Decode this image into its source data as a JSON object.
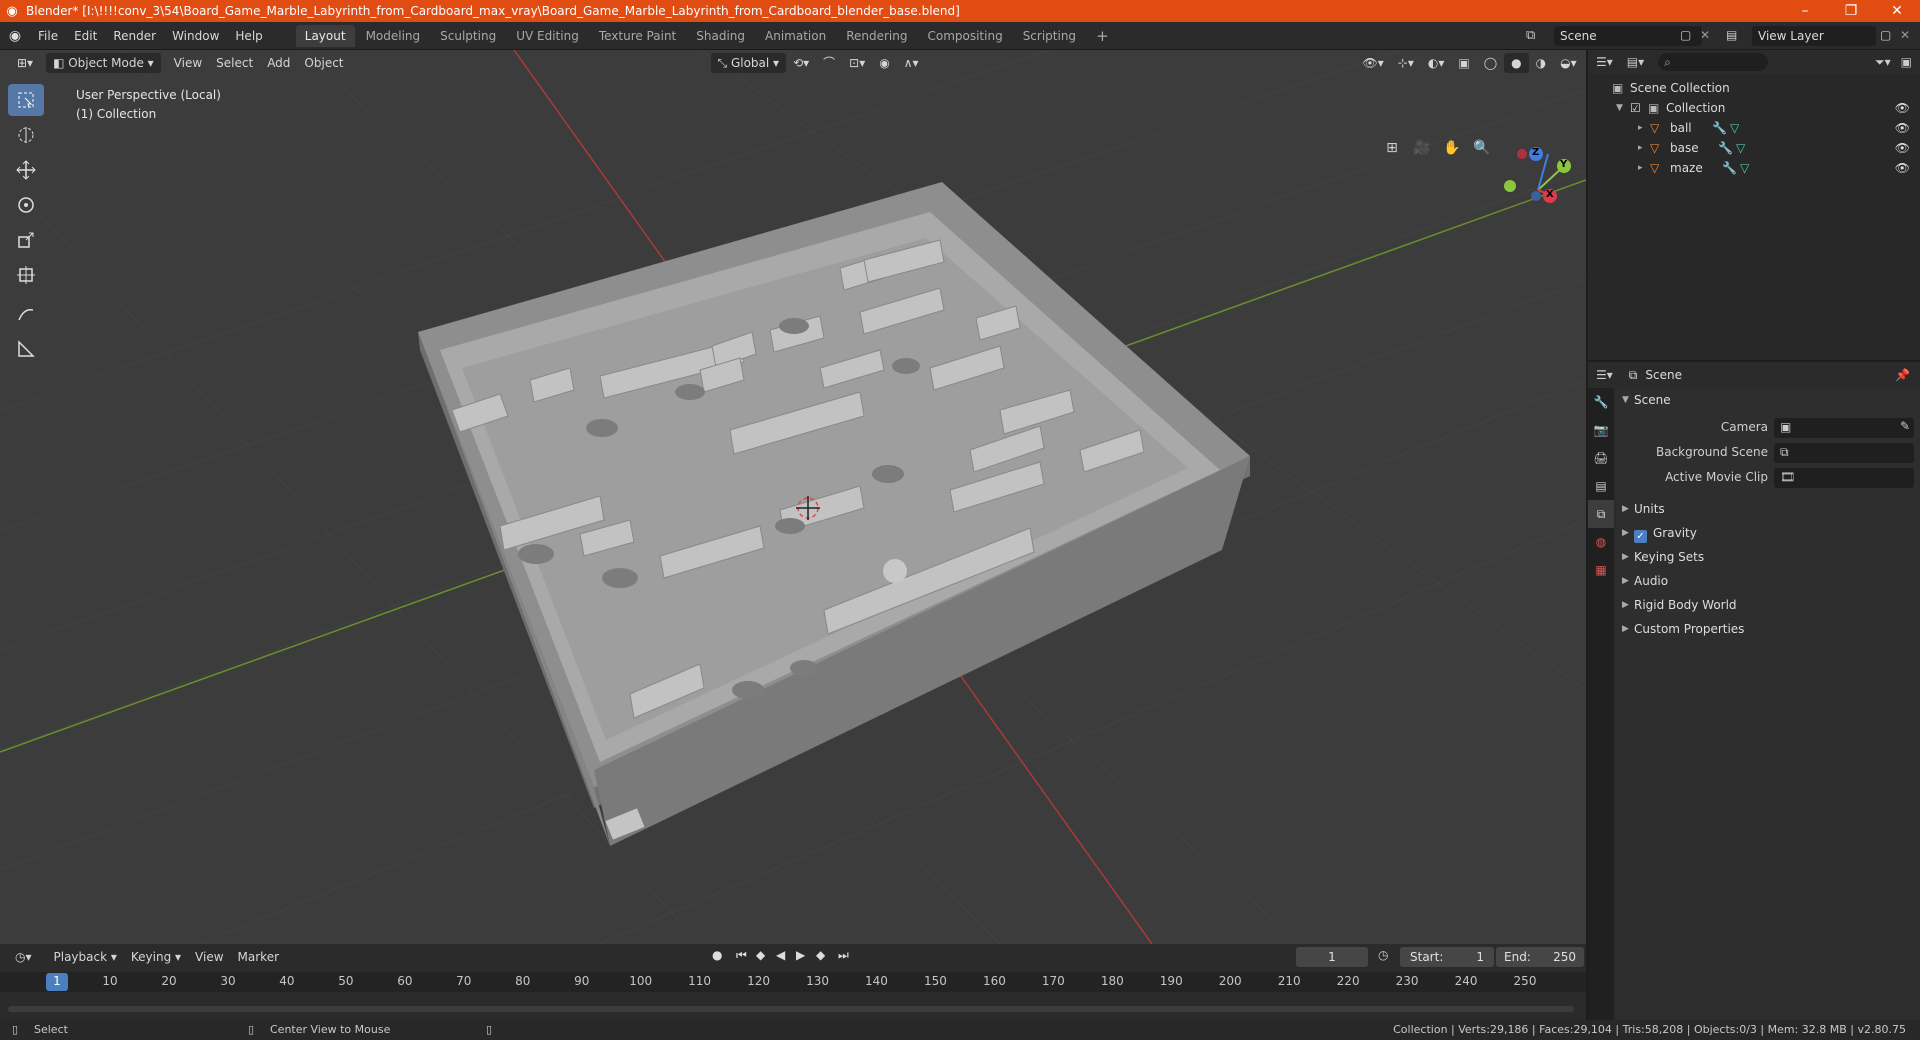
{
  "title": "Blender* [I:\\!!!!conv_3\\54\\Board_Game_Marble_Labyrinth_from_Cardboard_max_vray\\Board_Game_Marble_Labyrinth_from_Cardboard_blender_base.blend]",
  "menu": [
    "File",
    "Edit",
    "Render",
    "Window",
    "Help"
  ],
  "workspaces": [
    "Layout",
    "Modeling",
    "Sculpting",
    "UV Editing",
    "Texture Paint",
    "Shading",
    "Animation",
    "Rendering",
    "Compositing",
    "Scripting"
  ],
  "scene_name": "Scene",
  "view_layer": "View Layer",
  "viewport": {
    "mode": "Object Mode",
    "menus": [
      "View",
      "Select",
      "Add",
      "Object"
    ],
    "transform_orientation": "Global",
    "info_line1": "User Perspective (Local)",
    "info_line2": "(1) Collection",
    "gizmo": {
      "z": "Z",
      "y": "Y",
      "x": "X"
    }
  },
  "outliner": {
    "root": "Scene Collection",
    "collection": "Collection",
    "objects": [
      "ball",
      "base",
      "maze"
    ]
  },
  "properties": {
    "header": "Scene",
    "panel": "Scene",
    "fields": [
      {
        "label": "Camera"
      },
      {
        "label": "Background Scene"
      },
      {
        "label": "Active Movie Clip"
      }
    ],
    "subpanels": [
      "Units",
      "Gravity",
      "Keying Sets",
      "Audio",
      "Rigid Body World",
      "Custom Properties"
    ],
    "gravity_checked": true
  },
  "timeline": {
    "menus": [
      "Playback",
      "Keying",
      "View",
      "Marker"
    ],
    "current_frame": "1",
    "start_label": "Start:",
    "start": "1",
    "end_label": "End:",
    "end": "250",
    "ruler": [
      "1",
      "10",
      "20",
      "30",
      "40",
      "50",
      "60",
      "70",
      "80",
      "90",
      "100",
      "110",
      "120",
      "130",
      "140",
      "150",
      "160",
      "170",
      "180",
      "190",
      "200",
      "210",
      "220",
      "230",
      "240",
      "250"
    ]
  },
  "status": {
    "left": "Select",
    "middle": "Center View to Mouse",
    "right": "Collection | Verts:29,186 | Faces:29,104 | Tris:58,208 | Objects:0/3 | Mem: 32.8 MB | v2.80.75"
  },
  "colors": {
    "accent": "#e04c12",
    "selected": "#5578a8",
    "x_axis": "#e0394a",
    "y_axis": "#8cc63f",
    "z_axis": "#3e7ee0"
  }
}
